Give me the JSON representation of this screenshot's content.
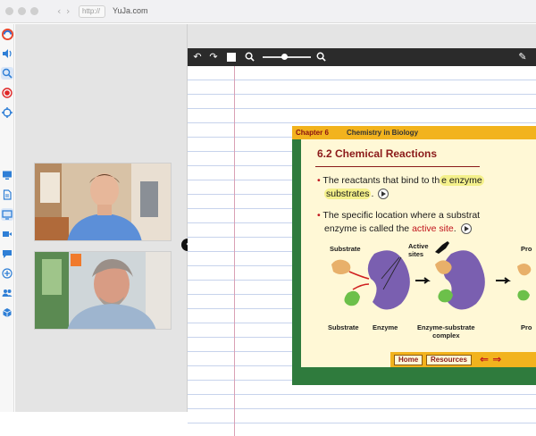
{
  "browser": {
    "url_chip": "http://",
    "url": "YuJa.com",
    "back_glyph": "‹",
    "forward_glyph": "›"
  },
  "sidebar": {
    "icons": [
      "yuja-logo-icon",
      "speaker-icon",
      "search-icon",
      "record-icon",
      "target-icon",
      "monitor-icon",
      "document-icon",
      "screen-share-icon",
      "video-icon",
      "chat-icon",
      "add-icon",
      "users-icon",
      "cube-icon"
    ]
  },
  "stage": {
    "collapse_glyph": "‹"
  },
  "toolbar": {
    "undo_glyph": "↶",
    "redo_glyph": "↷",
    "pen_glyph": "✎",
    "zoom_level": 0.45
  },
  "slide": {
    "chapter": "Chapter 6",
    "chapter_title": "Chemistry in Biology",
    "section": "6.2 Chemical Reactions",
    "bullet1_a": "The reactants that bind to th",
    "bullet1_b": "e enzyme",
    "bullet1_c": "substrates",
    "bullet1_d": ".",
    "bullet2_a": "The specific location where a substrat",
    "bullet2_b": "enzyme is called the ",
    "bullet2_c": "active site",
    "bullet2_d": ".",
    "diagram": {
      "substrate_top": "Substrate",
      "active_sites": "Active\nsites",
      "pro_top": "Pro",
      "substrate_bottom": "Substrate",
      "enzyme": "Enzyme",
      "complex": "Enzyme-substrate\ncomplex",
      "pro_bottom": "Pro"
    },
    "footer": {
      "home": "Home",
      "resources": "Resources",
      "arrows": "⇐ ⇒"
    }
  },
  "colors": {
    "accent": "#f2b31e",
    "slide_border": "#2f7b3d",
    "title_red": "#8b1a1a",
    "highlight": "#f4f08a"
  }
}
